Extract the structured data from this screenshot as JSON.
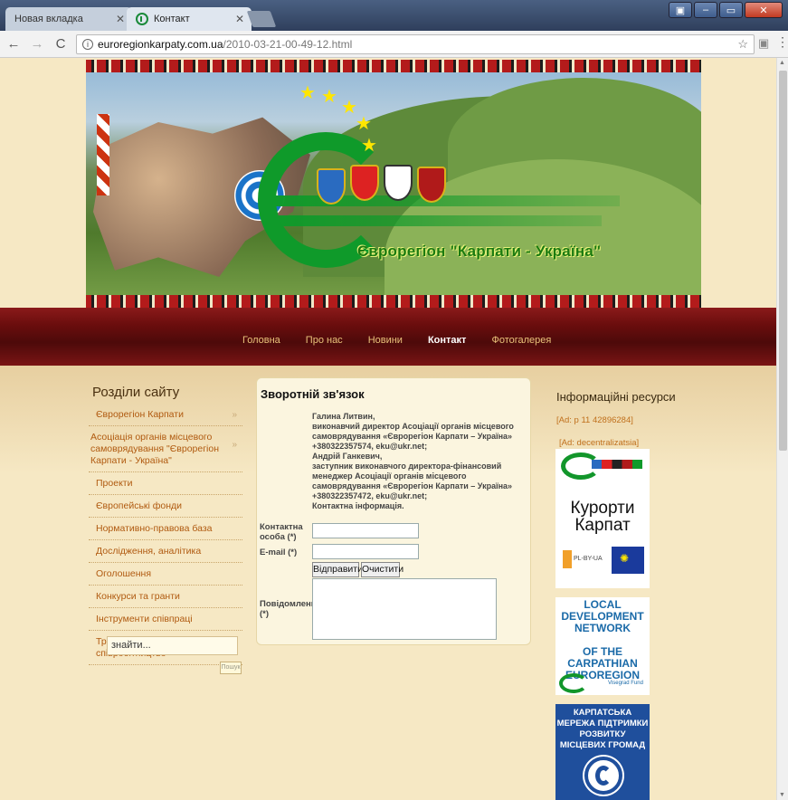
{
  "browser": {
    "tabs": [
      {
        "label": "Новая вкладка",
        "active": false
      },
      {
        "label": "Контакт",
        "active": true
      }
    ],
    "url_host": "euroregionkarpaty.com.ua",
    "url_path": "/2010-03-21-00-49-12.html",
    "icons": [
      "back-icon",
      "forward-icon",
      "reload-icon",
      "home-icon",
      "info-icon",
      "star-icon",
      "extension-icon",
      "menu-icon"
    ]
  },
  "banner": {
    "title": "Єврорегіон \"Карпати - Україна\""
  },
  "nav": {
    "items": [
      "Головна",
      "Про нас",
      "Новини",
      "Контакт",
      "Фотогалерея"
    ],
    "active": "Контакт"
  },
  "sidebar": {
    "title": "Розділи сайту",
    "items": [
      {
        "label": "Єврорегіон Карпати",
        "arrow": "»"
      },
      {
        "label": "Асоціація органів місцевого самоврядування \"Єврорегіон Карпати - Україна\"",
        "arrow": "»"
      },
      {
        "label": "Проекти",
        "arrow": ""
      },
      {
        "label": "Європейські фонди",
        "arrow": ""
      },
      {
        "label": "Нормативно-правова база",
        "arrow": ""
      },
      {
        "label": "Дослідження, аналітика",
        "arrow": ""
      },
      {
        "label": "Оголошення",
        "arrow": ""
      },
      {
        "label": "Конкурси та гранти",
        "arrow": ""
      },
      {
        "label": "Інструменти співпраці",
        "arrow": ""
      },
      {
        "label": "Транскордонне співробітництво",
        "arrow": "»"
      }
    ],
    "search_value": "знайти...",
    "search_button": "Пошук"
  },
  "contact": {
    "title": "Зворотній зв'язок",
    "lines": [
      "Галина Литвин,",
      "виконавчий директор Асоціації органів місцевого самоврядування «Єврорегіон Карпати – Україна»",
      "+380322357574, eku@ukr.net;",
      "Андрій Ганкевич,",
      "заступник виконавчого директора-фінансовий менеджер Асоціації органів місцевого самоврядування «Єврорегіон Карпати – Україна»",
      "+380322357472, eku@ukr.net;",
      "Контактна інформація."
    ],
    "label_person": "Контактна особа (*)",
    "label_email": "E-mail (*)",
    "label_message": "Повідомлення (*)",
    "send_button": "Відправити",
    "clear_button": "Очистити"
  },
  "resources": {
    "title": "Інформаційні ресурси",
    "ad1": "[Ad: p 11 42896284]",
    "ad2": "[Ad: decentralizatsia]",
    "card1_title": "Курорти Карпат",
    "card1_sub": "PL-BY-UA",
    "card2_line1": "LOCAL DEVELOPMENT NETWORK",
    "card2_line2": "OF THE CARPATHIAN EUROREGION",
    "card2_fund": "Visegrad Fund",
    "card3_title": "КАРПАТСЬКА МЕРЕЖА ПІДТРИМКИ РОЗВИТКУ МІСЦЕВИХ ГРОМАД"
  },
  "colors": {
    "page_bg": "#f6e8c4",
    "nav_band": "#6a0d0d",
    "link": "#b05a10",
    "logo_green": "#0f9a2a"
  }
}
